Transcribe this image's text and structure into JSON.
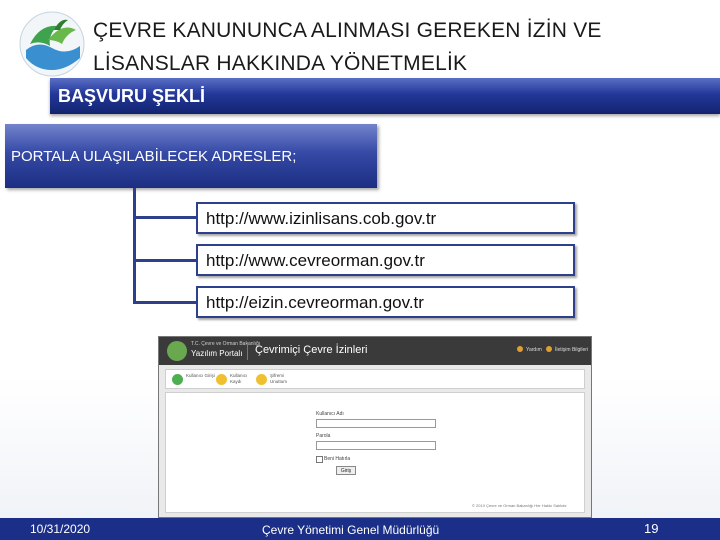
{
  "title": {
    "line1": "ÇEVRE KANUNUNCA  ALINMASI GEREKEN İZİN VE",
    "line2": "LİSANSLAR HAKKINDA YÖNETMELİK"
  },
  "section": {
    "heading": "BAŞVURU  ŞEKLİ"
  },
  "addresses": {
    "heading": "PORTALA  ULAŞILABİLECEK ADRESLER;",
    "urls": [
      "http://www.izinlisans.cob.gov.tr",
      "http://www.cevreorman.gov.tr",
      "http://eizin.cevreorman.gov.tr"
    ]
  },
  "screenshot": {
    "brand_top": "T.C. Çevre ve Orman Bakanlığı",
    "brand_name": "Yazılım Portalı",
    "app_title": "Çevrimiçi Çevre İzinleri",
    "help_link": "Yardım",
    "contact_link": "İletişim Bilgileri",
    "nav": [
      {
        "label": "Kullanıcı Girişi",
        "color": "#4caf50"
      },
      {
        "label": "Kullanıcı Kaydı",
        "color": "#f0c030"
      },
      {
        "label": "Şifremi Unuttum",
        "color": "#f0c030"
      }
    ],
    "username_label": "Kullanıcı Adı",
    "password_label": "Parola",
    "remember_label": "Beni Hatırla",
    "login_button": "Giriş",
    "copyright": "© 2010 Çevre ve Orman Bakanlığı Her Hakkı Saklıdır"
  },
  "footer": {
    "date": "10/31/2020",
    "org": "Çevre Yönetimi Genel Müdürlüğü",
    "page": "19"
  },
  "colors": {
    "bar_blue": "#23379a",
    "footer_blue": "#1b2f88",
    "connector": "#2e3f8c"
  }
}
